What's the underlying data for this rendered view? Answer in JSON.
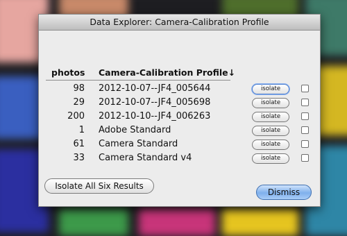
{
  "window": {
    "title": "Data Explorer: Camera-Calibration Profile"
  },
  "columns": {
    "photos": "photos",
    "profile": "Camera-Calibration Profile↓"
  },
  "rows": [
    {
      "count": "98",
      "name": "2012-10-07--JF4_005644",
      "isolate_label": "isolate"
    },
    {
      "count": "29",
      "name": "2012-10-07--JF4_005698",
      "isolate_label": "isolate"
    },
    {
      "count": "200",
      "name": "2012-10-10--JF4_006263",
      "isolate_label": "isolate"
    },
    {
      "count": "1",
      "name": "Adobe Standard",
      "isolate_label": "isolate"
    },
    {
      "count": "61",
      "name": "Camera Standard",
      "isolate_label": "isolate"
    },
    {
      "count": "33",
      "name": "Camera Standard v4",
      "isolate_label": "isolate"
    }
  ],
  "buttons": {
    "isolate_all": "Isolate All Six Results",
    "dismiss": "Dismiss"
  },
  "colors": {
    "accent": "#7fb0ec",
    "dialog_bg": "#ececec"
  }
}
